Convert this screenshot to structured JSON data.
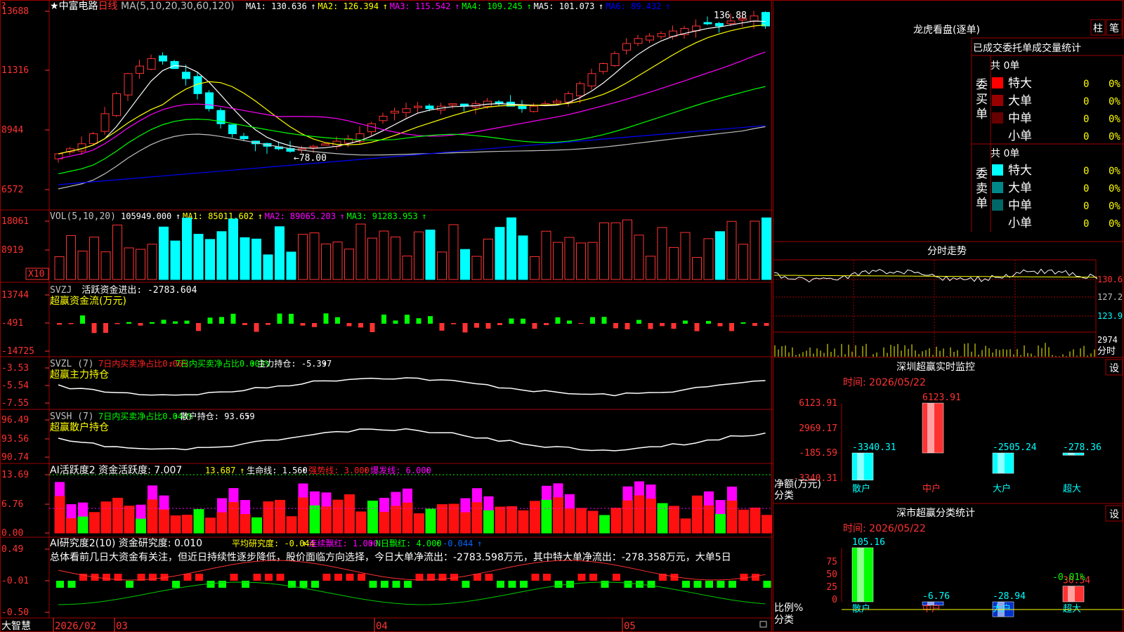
{
  "stock": {
    "name": "中富电路",
    "period": "日线",
    "star": "★"
  },
  "panels": {
    "price": {
      "ma_caption": "MA(5,10,20,30,60,120)",
      "ma_items": [
        {
          "text": "MA1: 130.636",
          "color": "#ffffff"
        },
        {
          "text": "MA2: 126.394",
          "color": "#ffff00"
        },
        {
          "text": "MA3: 115.542",
          "color": "#ff00ff"
        },
        {
          "text": "MA4: 109.245",
          "color": "#00ff00"
        },
        {
          "text": "MA5: 101.073",
          "color": "#ffffff"
        },
        {
          "text": "MA6: 89.432",
          "color": "#0000ff"
        }
      ],
      "ticks": [
        "13688",
        "11316",
        "8944",
        "6572"
      ],
      "high_label": "136.88",
      "low_label": "←78.00"
    },
    "vol": {
      "caption": "VOL(5,10,20)",
      "items": [
        {
          "text": "105949.000",
          "color": "#ffffff"
        },
        {
          "text": "MA1: 85011.602",
          "color": "#ffff00"
        },
        {
          "text": "MA2: 89065.203",
          "color": "#ff00ff"
        },
        {
          "text": "MA3: 91283.953",
          "color": "#00ff00"
        }
      ],
      "ticks": [
        "18061",
        "8919"
      ],
      "unit_tag": "X10"
    },
    "svzj": {
      "caption": "SVZJ",
      "line1": "活跃资金进出: -2783.604",
      "line2": "超赢资金流(万元)",
      "ticks": [
        "13744",
        "-491",
        "-14725"
      ]
    },
    "svzl": {
      "caption": "SVZL (7)",
      "items": [
        {
          "text": "7日内买卖净占比0.06%",
          "color": "#ff2020"
        },
        {
          "text": "7日内买卖净占比0.003%",
          "color": "#00ff00"
        },
        {
          "text": "主力持仓: -5.397",
          "color": "#ffffff"
        }
      ],
      "line2": "超赢主力持仓",
      "ticks": [
        "-3.53",
        "-5.54",
        "-7.55"
      ]
    },
    "svsh": {
      "caption": "SVSH (7)",
      "items": [
        {
          "text": "7日内买卖净占比0.044%",
          "color": "#00ff00"
        },
        {
          "text": "散户持仓: 93.659",
          "color": "#ffffff"
        }
      ],
      "line2": "超赢散户持仓",
      "ticks": [
        "96.49",
        "93.56",
        "90.74"
      ]
    },
    "ai_active": {
      "caption": "AI活跃度2 资金活跃度: 7.007",
      "items": [
        {
          "text": "13.687",
          "color": "#ffff00"
        },
        {
          "text": "生命线: 1.560",
          "color": "#ffffff"
        },
        {
          "text": "强势线: 3.000",
          "color": "#ff2020"
        },
        {
          "text": "爆发线: 6.000",
          "color": "#ff00ff"
        }
      ],
      "ticks": [
        "13.69",
        "6.76",
        "0.00"
      ]
    },
    "ai_research": {
      "caption": "AI研究度2(10) 资金研究度: 0.010",
      "items": [
        {
          "text": "平均研究度: -0.044",
          "color": "#ffff00"
        },
        {
          "text": "连续飘红: 1.000",
          "color": "#ff00ff"
        },
        {
          "text": "N日飘红: 4.000",
          "color": "#00ff00"
        },
        {
          "text": "-0.044",
          "color": "#0066ff"
        }
      ],
      "summary": "总体看前几日大资金有关注，但近日持续性逐步降低，股价面临方向选择，今日大单净流出：-2783.598万元，其中特大单净流出：-278.358万元，大单5日",
      "ticks": [
        "0.49",
        "-0.01",
        "-0.50"
      ]
    }
  },
  "date_axis": {
    "labels": [
      "2026/02",
      "03",
      "04",
      "05"
    ],
    "brand": "大智慧"
  },
  "sidebar": {
    "dragon_tiger": {
      "title": "龙虎看盘(逐单)",
      "btn_bar": "柱",
      "btn_pen": "笔",
      "tab_text": "已成交委托单成交量统计",
      "buy_side_label": "委买单",
      "sell_side_label": "委卖单",
      "buy_total": "共 0单",
      "sell_total": "共 0单",
      "buy_rows": [
        {
          "label": "特大",
          "count": "0",
          "pct": "0%",
          "color": "#ff0000"
        },
        {
          "label": "大单",
          "count": "0",
          "pct": "0%",
          "color": "#990000"
        },
        {
          "label": "中单",
          "count": "0",
          "pct": "0%",
          "color": "#660000"
        },
        {
          "label": "小单",
          "count": "0",
          "pct": "0%",
          "color": "#000000"
        }
      ],
      "sell_rows": [
        {
          "label": "特大",
          "count": "0",
          "pct": "0%",
          "color": "#00ffff"
        },
        {
          "label": "大单",
          "count": "0",
          "pct": "0%",
          "color": "#008888"
        },
        {
          "label": "中单",
          "count": "0",
          "pct": "0%",
          "color": "#006666"
        },
        {
          "label": "小单",
          "count": "0",
          "pct": "0%",
          "color": "#000000"
        }
      ]
    },
    "intraday": {
      "title": "分时走势",
      "ticks": [
        "130.6",
        "127.2",
        "123.9"
      ],
      "vol_tick": "2974",
      "vol_label": "分时"
    },
    "sz_monitor": {
      "title": "深圳超赢实时监控",
      "set_btn": "设",
      "time": "时间: 2026/05/22",
      "ticks": [
        "6123.91",
        "2969.17",
        "-185.59",
        "-3340.31"
      ],
      "axis_label1": "净额(万元)",
      "axis_label2": "分类",
      "chart_data": {
        "type": "bar",
        "categories": [
          "散户",
          "中户",
          "大户",
          "超大"
        ],
        "values": [
          -3340.31,
          6123.91,
          -2505.24,
          -278.36
        ],
        "value_labels": [
          "-3340.31",
          "6123.91",
          "-2505.24",
          "-278.36"
        ],
        "ylabel": "净额(万元)",
        "xlabel": "分类",
        "ylim": [
          -3340.31,
          6123.91
        ]
      }
    },
    "sz_class": {
      "title": "深市超赢分类统计",
      "set_btn": "设",
      "time": "时间: 2026/05/22",
      "ticks": [
        "75",
        "50",
        "25",
        "0"
      ],
      "axis_label1": "比例%",
      "axis_label2": "分类",
      "chart_data": {
        "type": "bar",
        "categories": [
          "散户",
          "中户",
          "大户",
          "超大"
        ],
        "values": [
          105.16,
          -6.76,
          -28.94,
          30.54
        ],
        "value_labels": [
          "105.16",
          "-6.76",
          "-28.94",
          "30.54"
        ],
        "extra_label": "-0.01%",
        "ylabel": "比例%",
        "xlabel": "分类",
        "ylim": [
          0,
          105.16
        ]
      }
    }
  },
  "colors": {
    "up": "#ff3232",
    "down": "#00ffff",
    "grid": "#a00000",
    "axis_text": "#ff3232"
  }
}
